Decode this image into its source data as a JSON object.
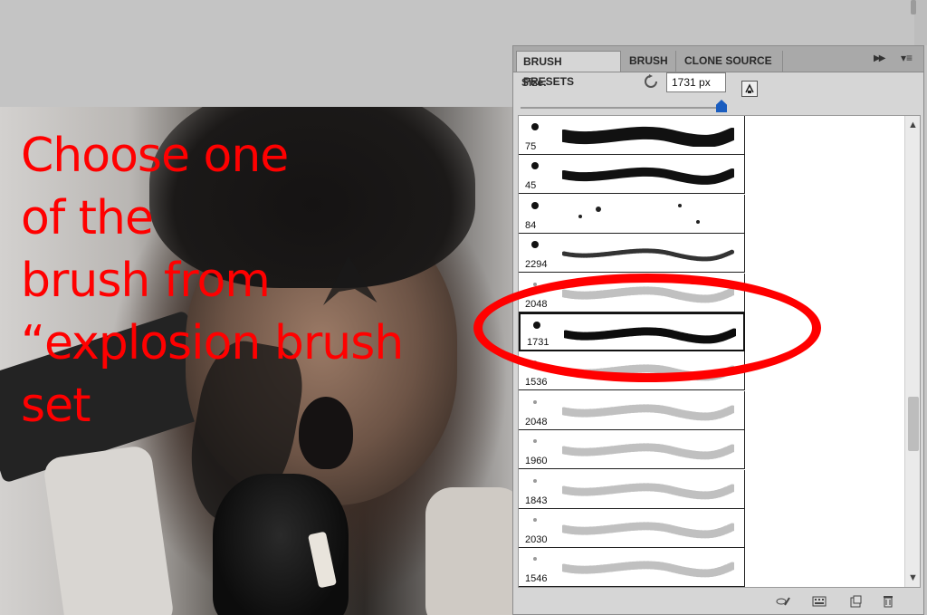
{
  "annotation": {
    "text": "Choose one\nof the\nbrush from\n“explosion brush\nset",
    "color": "#ff0000"
  },
  "panel": {
    "tabs": [
      {
        "label": "BRUSH PRESETS",
        "active": true
      },
      {
        "label": "BRUSH",
        "active": false
      },
      {
        "label": "CLONE SOURCE",
        "active": false
      }
    ],
    "size_label": "Size:",
    "size_value": "1731 px",
    "slider_level": 1.0,
    "presets": [
      {
        "size": "75",
        "style": "hard-round"
      },
      {
        "size": "45",
        "style": "hard-round"
      },
      {
        "size": "84",
        "style": "scatter"
      },
      {
        "size": "2294",
        "style": "rough"
      },
      {
        "size": "2048",
        "style": "faint"
      },
      {
        "size": "1731",
        "style": "dark",
        "selected": true
      },
      {
        "size": "1536",
        "style": "faint"
      },
      {
        "size": "2048",
        "style": "faint"
      },
      {
        "size": "1960",
        "style": "faint"
      },
      {
        "size": "1843",
        "style": "faint"
      },
      {
        "size": "2030",
        "style": "faint"
      },
      {
        "size": "1546",
        "style": "faint"
      }
    ],
    "footer_icons": [
      "toggle-brush-panel-icon",
      "brush-settings-icon",
      "new-preset-icon",
      "delete-icon"
    ]
  },
  "colors": {
    "highlight": "#ff0000",
    "slider_thumb": "#1a5dbf"
  }
}
